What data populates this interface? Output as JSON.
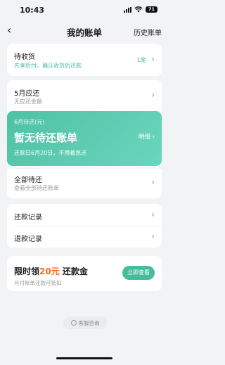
{
  "status_bar": {
    "time": "10:43",
    "battery": "71"
  },
  "nav": {
    "title": "我的账单",
    "history_label": "历史账单"
  },
  "pending_receipt": {
    "title": "待收货",
    "subtitle": "先享后付，确认收货后还款",
    "count": "1笔"
  },
  "may_due": {
    "title": "5月应还",
    "subtitle": "无应还金额"
  },
  "hero": {
    "period": "6月待还(元)",
    "status": "暂无待还账单",
    "due_note": "还款日6月20日，不用着急还",
    "detail_label": "明细"
  },
  "all_pending": {
    "title": "全部待还",
    "subtitle": "查看全部待还账单"
  },
  "repay_records": {
    "title": "还款记录"
  },
  "refund_records": {
    "title": "退款记录"
  },
  "promo": {
    "title_prefix": "限时领",
    "amount": "20元",
    "title_suffix": " 还款金",
    "subtitle": "月付账单还款可抵扣",
    "button": "立即查看"
  },
  "customer_service": {
    "label": "客服咨询"
  },
  "colors": {
    "accent": "#46bc9c",
    "promo_amount": "#ff6a1a",
    "background": "#f2f3f5"
  }
}
